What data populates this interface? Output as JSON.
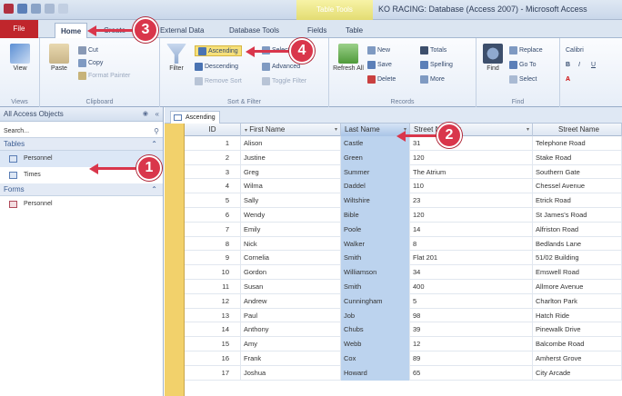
{
  "window": {
    "title": "KO RACING: Database (Access 2007) - Microsoft Access",
    "context_tab": "Table Tools"
  },
  "tabs": [
    "File",
    "Home",
    "Create",
    "External Data",
    "Database Tools",
    "Fields",
    "Table"
  ],
  "ribbon": {
    "views": {
      "view_label": "View",
      "group_label": "Views"
    },
    "clipboard": {
      "paste_label": "Paste",
      "cut_label": "Cut",
      "copy_label": "Copy",
      "format_painter_label": "Format Painter",
      "group_label": "Clipboard"
    },
    "sort_filter": {
      "filter_label": "Filter",
      "ascending_label": "Ascending",
      "descending_label": "Descending",
      "remove_sort_label": "Remove Sort",
      "advanced_label": "Advanced",
      "selection_label": "Selection",
      "toggle_filter_label": "Toggle Filter",
      "group_label": "Sort & Filter"
    },
    "records": {
      "refresh_label": "Refresh All",
      "new_label": "New",
      "save_label": "Save",
      "delete_label": "Delete",
      "totals_label": "Totals",
      "spelling_label": "Spelling",
      "more_label": "More",
      "group_label": "Records"
    },
    "find": {
      "find_label": "Find",
      "replace_label": "Replace",
      "goto_label": "Go To",
      "select_label": "Select",
      "group_label": "Find"
    },
    "text_formatting": {
      "font_label": "Calibri"
    }
  },
  "nav": {
    "header": "All Access Objects",
    "search_placeholder": "Search...",
    "sections": [
      {
        "label": "Tables",
        "items": [
          "Personnel",
          "Times"
        ]
      },
      {
        "label": "Forms",
        "items": [
          "Personnel"
        ]
      }
    ]
  },
  "object_tab": {
    "label": "Ascending"
  },
  "datasheet": {
    "columns": [
      "ID",
      "First Name",
      "Last Name",
      "Street Number",
      "Street Name"
    ],
    "rows": [
      [
        "1",
        "Alison",
        "Castle",
        "31",
        "Telephone Road"
      ],
      [
        "2",
        "Justine",
        "Green",
        "120",
        "Stake Road"
      ],
      [
        "3",
        "Greg",
        "Summer",
        "The Atrium",
        "Southern Gate"
      ],
      [
        "4",
        "Wilma",
        "Daddel",
        "110",
        "Chessel Avenue"
      ],
      [
        "5",
        "Sally",
        "Wiltshire",
        "23",
        "Etrick Road"
      ],
      [
        "6",
        "Wendy",
        "Bible",
        "120",
        "St James's Road"
      ],
      [
        "7",
        "Emily",
        "Poole",
        "14",
        "Alfriston Road"
      ],
      [
        "8",
        "Nick",
        "Walker",
        "8",
        "Bedlands Lane"
      ],
      [
        "9",
        "Cornelia",
        "Smith",
        "Flat 201",
        "51/02 Building"
      ],
      [
        "10",
        "Gordon",
        "Williamson",
        "34",
        "Emswell Road"
      ],
      [
        "11",
        "Susan",
        "Smith",
        "400",
        "Allmore Avenue"
      ],
      [
        "12",
        "Andrew",
        "Cunningham",
        "5",
        "Charlton Park"
      ],
      [
        "13",
        "Paul",
        "Job",
        "98",
        "Hatch Ride"
      ],
      [
        "14",
        "Anthony",
        "Chubs",
        "39",
        "Pinewalk Drive"
      ],
      [
        "15",
        "Amy",
        "Webb",
        "12",
        "Balcombe Road"
      ],
      [
        "16",
        "Frank",
        "Cox",
        "89",
        "Amherst Grove"
      ],
      [
        "17",
        "Joshua",
        "Howard",
        "65",
        "City Arcade"
      ]
    ]
  },
  "callouts": [
    "1",
    "2",
    "3",
    "4"
  ],
  "colors": {
    "callout": "#d9364b",
    "file_tab": "#c0262c",
    "selected_column": "#bcd3ee",
    "record_selector": "#f2d16b"
  }
}
